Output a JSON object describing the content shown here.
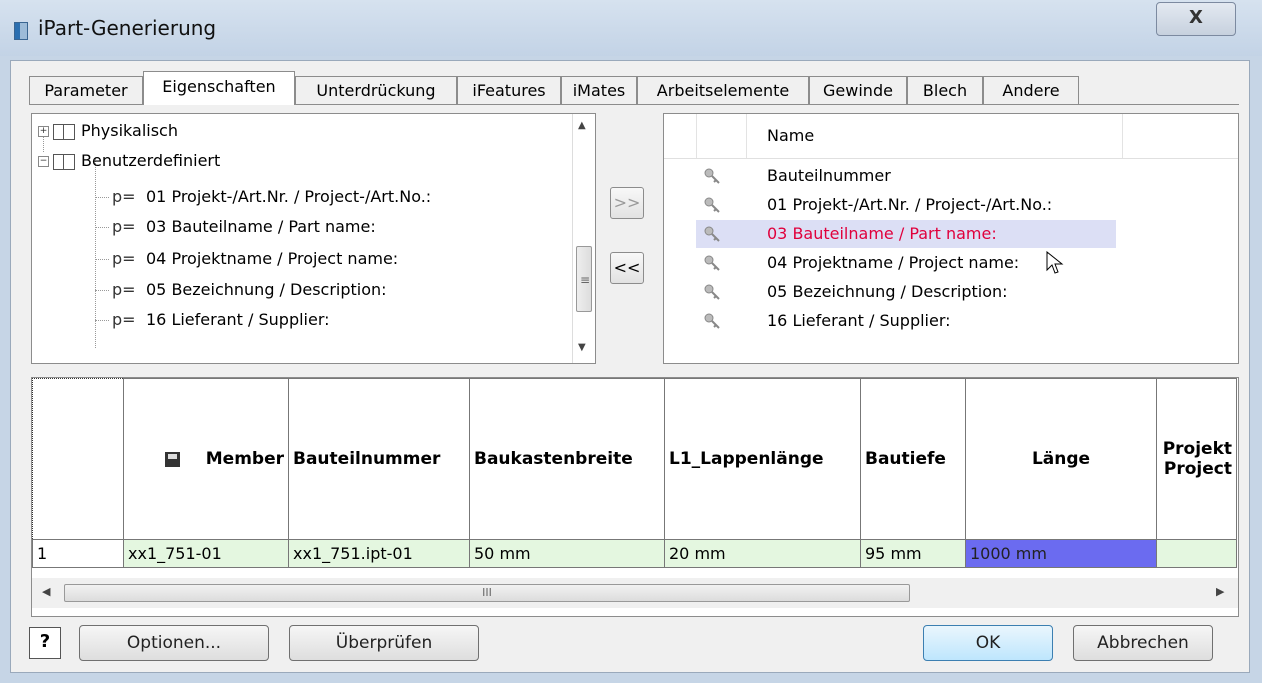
{
  "window": {
    "title": "iPart-Generierung",
    "close_label": "X"
  },
  "tabs": [
    "Parameter",
    "Eigenschaften",
    "Unterdrückung",
    "iFeatures",
    "iMates",
    "Arbeitselemente",
    "Gewinde",
    "Blech",
    "Andere"
  ],
  "active_tab": "Eigenschaften",
  "tree": {
    "groups": [
      {
        "label": "Physikalisch",
        "expander": "+"
      },
      {
        "label": "Benutzerdefiniert",
        "expander": "−"
      }
    ],
    "prefix": "p=",
    "items": [
      "01 Projekt-/Art.Nr. / Project-/Art.No.:",
      "03 Bauteilname / Part name:",
      "04 Projektname / Project name:",
      "05 Bezeichnung / Description:",
      "16 Lieferant / Supplier:"
    ]
  },
  "move_buttons": {
    "add": ">>",
    "remove": "<<"
  },
  "selected_list": {
    "header": "Name",
    "items": [
      "Bauteilnummer",
      "01 Projekt-/Art.Nr. / Project-/Art.No.:",
      "03 Bauteilname / Part name:",
      "04 Projektname / Project name:",
      "05 Bezeichnung / Description:",
      "16 Lieferant / Supplier:"
    ],
    "selected": "03 Bauteilname / Part name:",
    "selected_color": "#e0003c"
  },
  "grid": {
    "columns": [
      "Member",
      "Bauteilnummer",
      "Baukastenbreite",
      "L1_Lappenlänge",
      "Bautiefe",
      "Länge",
      "Projekt Project"
    ],
    "rows": [
      {
        "num": "1",
        "cells": [
          "xx1_751-01",
          "xx1_751.ipt-01",
          "50 mm",
          "20 mm",
          "95 mm",
          "1000 mm",
          ""
        ]
      }
    ],
    "highlight_color": "#6b6bf0",
    "row_color": "#e4f7e0",
    "scroll_grip": "III"
  },
  "buttons": {
    "help": "?",
    "options": "Optionen...",
    "check": "Überprüfen",
    "ok": "OK",
    "cancel": "Abbrechen"
  }
}
